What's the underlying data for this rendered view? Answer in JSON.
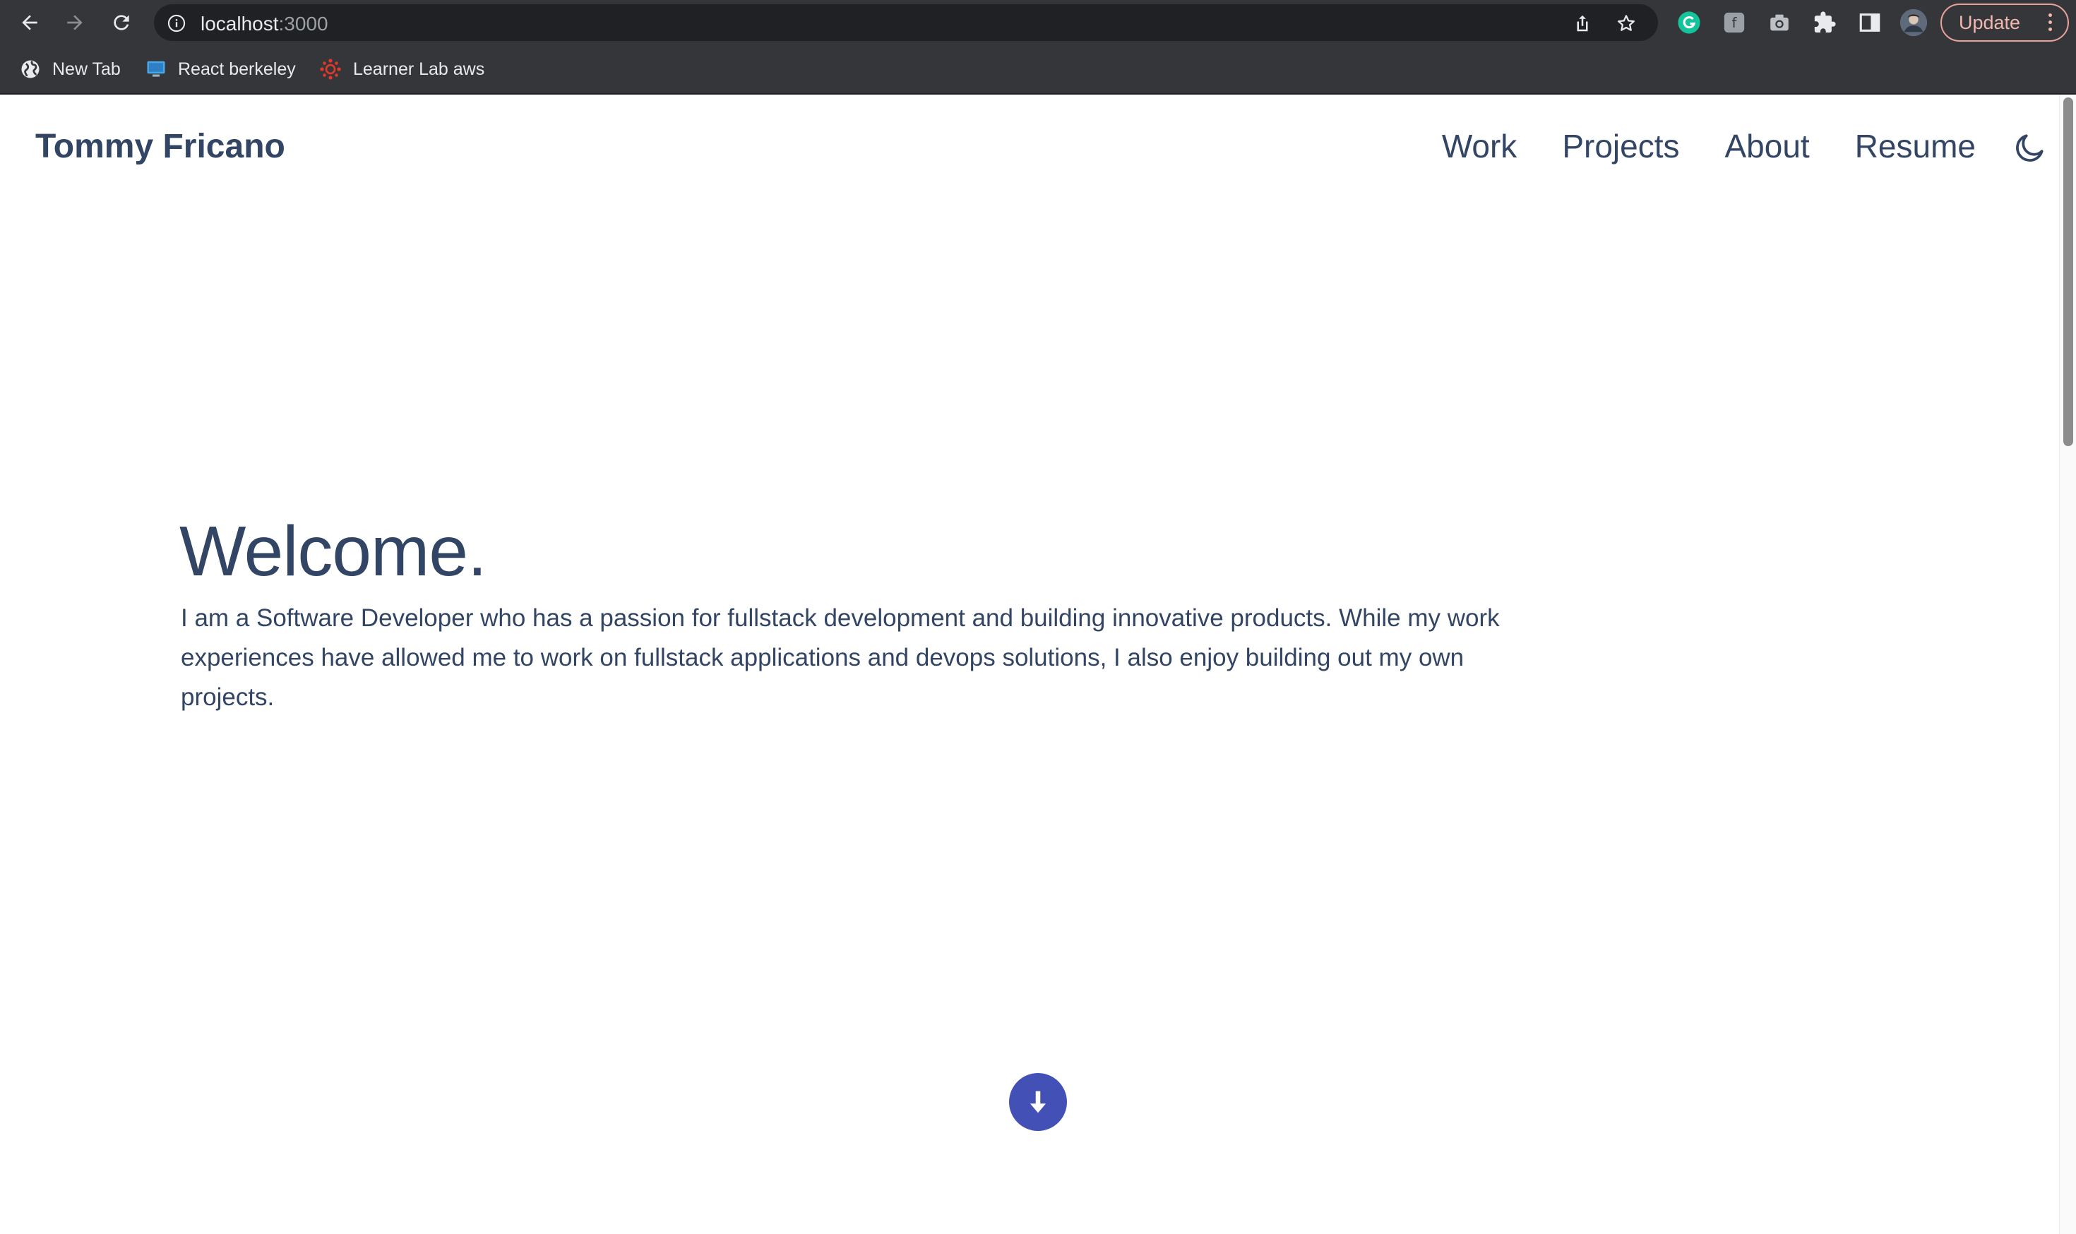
{
  "browser": {
    "url_host": "localhost",
    "url_port": ":3000",
    "update_label": "Update",
    "bookmarks": [
      {
        "label": "New Tab",
        "icon": "globe-icon"
      },
      {
        "label": "React berkeley",
        "icon": "monitor-icon"
      },
      {
        "label": "Learner Lab aws",
        "icon": "canvas-icon"
      }
    ],
    "extensions": [
      "grammarly-icon",
      "extension-f-icon",
      "camera-icon",
      "puzzle-icon",
      "sidepanel-icon",
      "profile-avatar"
    ]
  },
  "site": {
    "name": "Tommy Fricano",
    "nav": [
      "Work",
      "Projects",
      "About",
      "Resume"
    ],
    "theme_toggle_icon": "moon-icon"
  },
  "hero": {
    "title": "Welcome.",
    "text": "I am a Software Developer who has a passion for fullstack development and building innovative products. While my work experiences have allowed me to work on fullstack applications and devops solutions, I also enjoy building out my own projects."
  },
  "colors": {
    "text": "#334565",
    "accent": "#4351b6",
    "chrome": "#35363a"
  }
}
